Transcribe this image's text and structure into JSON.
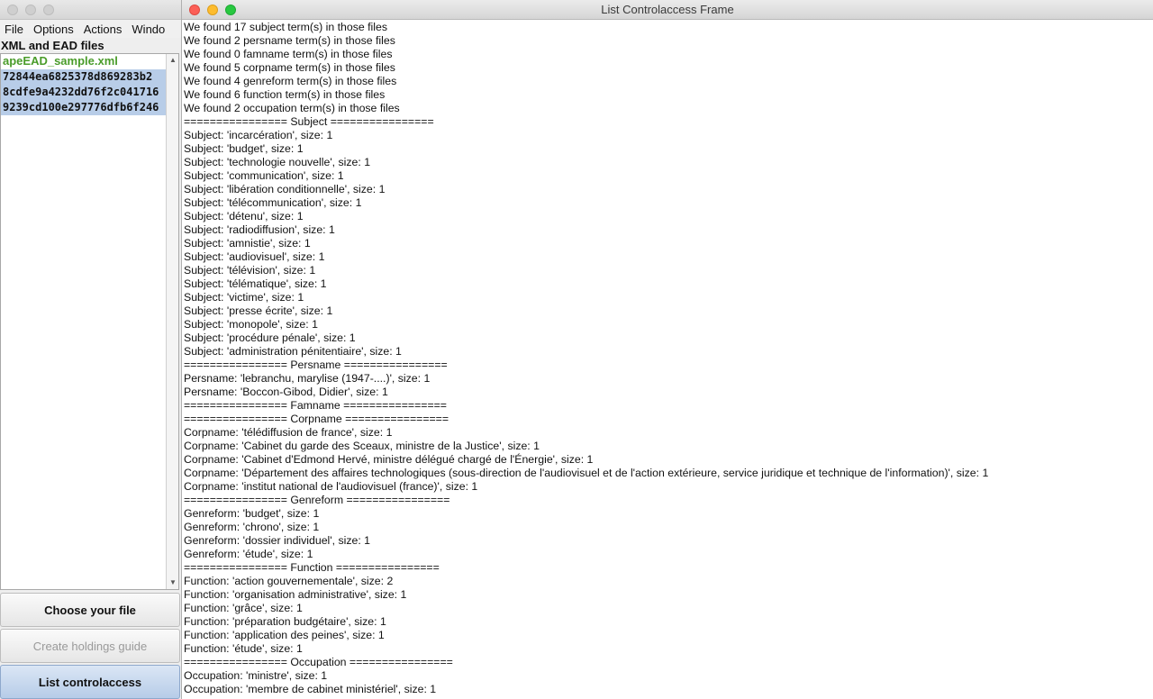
{
  "main": {
    "menu": [
      "File",
      "Options",
      "Actions",
      "Windo"
    ],
    "files_label": "XML and EAD files",
    "files": [
      {
        "name": "apeEAD_sample.xml",
        "style": "green"
      },
      {
        "name": "72844ea6825378d869283b2",
        "style": "sel"
      },
      {
        "name": "8cdfe9a4232dd76f2c041716",
        "style": "sel"
      },
      {
        "name": "9239cd100e297776dfb6f246",
        "style": "sel"
      }
    ],
    "buttons": {
      "choose": "Choose your file",
      "create": "Create holdings guide",
      "list": "List controlaccess"
    }
  },
  "frame": {
    "title": "List Controlaccess Frame",
    "lines": [
      "We found 17 subject term(s) in those files",
      "We found 2 persname term(s) in those files",
      "We found 0 famname term(s) in those files",
      "We found 5 corpname term(s) in those files",
      "We found 4 genreform term(s) in those files",
      "We found 6 function term(s) in those files",
      "We found 2 occupation term(s) in those files",
      "================ Subject ================",
      "Subject: 'incarcération', size: 1",
      "Subject: 'budget', size: 1",
      "Subject: 'technologie nouvelle', size: 1",
      "Subject: 'communication', size: 1",
      "Subject: 'libération conditionnelle', size: 1",
      "Subject: 'télécommunication', size: 1",
      "Subject: 'détenu', size: 1",
      "Subject: 'radiodiffusion', size: 1",
      "Subject: 'amnistie', size: 1",
      "Subject: 'audiovisuel', size: 1",
      "Subject: 'télévision', size: 1",
      "Subject: 'télématique', size: 1",
      "Subject: 'victime', size: 1",
      "Subject: 'presse écrite', size: 1",
      "Subject: 'monopole', size: 1",
      "Subject: 'procédure pénale', size: 1",
      "Subject: 'administration pénitentiaire', size: 1",
      "================ Persname ================",
      "Persname: 'lebranchu, marylise (1947-....)', size: 1",
      "Persname: 'Boccon-Gibod, Didier', size: 1",
      "================ Famname ================",
      "================ Corpname ================",
      "Corpname: 'télédiffusion de france', size: 1",
      "Corpname: 'Cabinet du garde des Sceaux, ministre de la Justice', size: 1",
      "Corpname: 'Cabinet d'Edmond Hervé, ministre délégué chargé de l'Énergie', size: 1",
      "Corpname: 'Département des affaires technologiques (sous-direction de l'audiovisuel et de l'action extérieure, service juridique et technique de l'information)', size: 1",
      "Corpname: 'institut national de l'audiovisuel (france)', size: 1",
      "================ Genreform ================",
      "Genreform: 'budget', size: 1",
      "Genreform: 'chrono', size: 1",
      "Genreform: 'dossier individuel', size: 1",
      "Genreform: 'étude', size: 1",
      "================ Function ================",
      "Function: 'action gouvernementale', size: 2",
      "Function: 'organisation administrative', size: 1",
      "Function: 'grâce', size: 1",
      "Function: 'préparation budgétaire', size: 1",
      "Function: 'application des peines', size: 1",
      "Function: 'étude', size: 1",
      "================ Occupation ================",
      "Occupation: 'ministre', size: 1",
      "Occupation: 'membre de cabinet ministériel', size: 1"
    ]
  },
  "colors": {
    "accent_green": "#4a9c2a",
    "selection": "#b8cde8"
  }
}
